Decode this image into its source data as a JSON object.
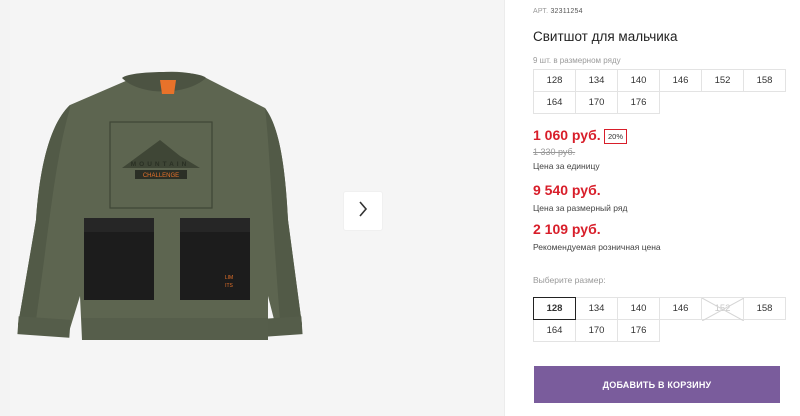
{
  "product": {
    "article_label": "АРТ.",
    "article_number": "32311254",
    "title": "Свитшот для мальчика",
    "image_text": {
      "print_word": "MOUNTAIN",
      "badge": "CHALLENGE",
      "patch_top": "LIM",
      "patch_bottom": "ITS"
    }
  },
  "size_range": {
    "caption": "9 шт. в размерном ряду",
    "sizes": [
      "128",
      "134",
      "140",
      "146",
      "152",
      "158",
      "164",
      "170",
      "176"
    ]
  },
  "pricing": {
    "unit_price": "1 060 руб.",
    "discount": "20%",
    "old_price": "1 330 руб.",
    "unit_label": "Цена за единицу",
    "range_price": "9 540 руб.",
    "range_label": "Цена за размерный ряд",
    "retail_price": "2 109 руб.",
    "retail_label": "Рекомендуемая розничная цена"
  },
  "size_select": {
    "caption": "Выберите размер:",
    "sizes": [
      "128",
      "134",
      "140",
      "146",
      "152",
      "158",
      "164",
      "170",
      "176"
    ],
    "selected": "128",
    "unavailable": [
      "152"
    ]
  },
  "cart_button": {
    "label": "ДОБАВИТЬ В КОРЗИНУ"
  },
  "gallery": {
    "next_icon": "chevron-right-icon"
  },
  "colors": {
    "price": "#d81e2a",
    "button": "#7a5c9c",
    "garment": "#5d6550",
    "pocket": "#1c1c1c"
  }
}
